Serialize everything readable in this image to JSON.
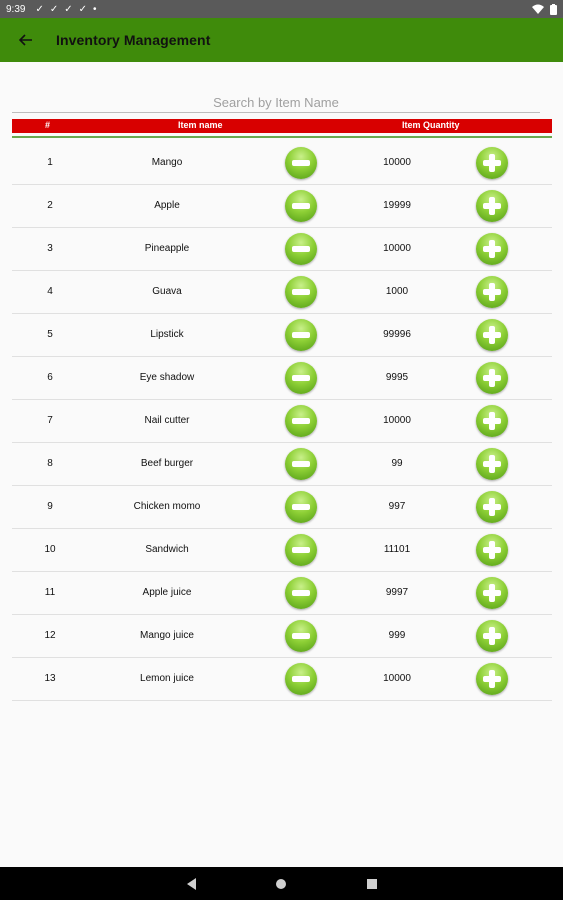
{
  "status": {
    "time": "9:39"
  },
  "appbar": {
    "title": "Inventory Management"
  },
  "search": {
    "placeholder": "Search by Item Name"
  },
  "table": {
    "headers": {
      "number": "#",
      "name": "Item name",
      "quantity": "Item Quantity"
    },
    "rows": [
      {
        "number": "1",
        "name": "Mango",
        "quantity": "10000"
      },
      {
        "number": "2",
        "name": "Apple",
        "quantity": "19999"
      },
      {
        "number": "3",
        "name": "Pineapple",
        "quantity": "10000"
      },
      {
        "number": "4",
        "name": "Guava",
        "quantity": "1000"
      },
      {
        "number": "5",
        "name": "Lipstick",
        "quantity": "99996"
      },
      {
        "number": "6",
        "name": "Eye shadow",
        "quantity": "9995"
      },
      {
        "number": "7",
        "name": "Nail cutter",
        "quantity": "10000"
      },
      {
        "number": "8",
        "name": "Beef burger",
        "quantity": "99"
      },
      {
        "number": "9",
        "name": "Chicken momo",
        "quantity": "997"
      },
      {
        "number": "10",
        "name": "Sandwich",
        "quantity": "11101"
      },
      {
        "number": "11",
        "name": "Apple juice",
        "quantity": "9997"
      },
      {
        "number": "12",
        "name": "Mango juice",
        "quantity": "999"
      },
      {
        "number": "13",
        "name": "Lemon juice",
        "quantity": "10000"
      }
    ]
  },
  "colors": {
    "appbar": "#3f8b0b",
    "table_header": "#d80000",
    "button_green": "#8ed036"
  }
}
